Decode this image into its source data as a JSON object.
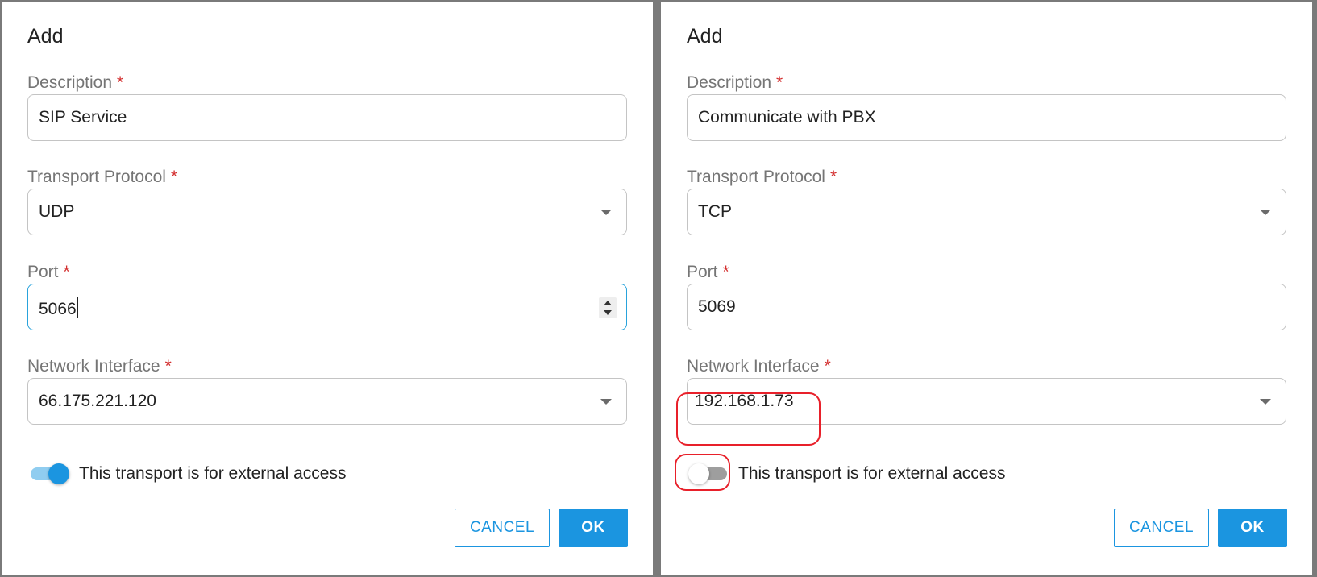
{
  "dialogs": [
    {
      "title": "Add",
      "description_label": "Description",
      "description_value": "SIP Service",
      "protocol_label": "Transport Protocol",
      "protocol_value": "UDP",
      "port_label": "Port",
      "port_value": "5066",
      "interface_label": "Network Interface",
      "interface_value": "66.175.221.120",
      "external_access_label": "This transport is for external access",
      "external_access_on": true,
      "cancel_label": "CANCEL",
      "ok_label": "OK"
    },
    {
      "title": "Add",
      "description_label": "Description",
      "description_value": "Communicate with PBX",
      "protocol_label": "Transport Protocol",
      "protocol_value": "TCP",
      "port_label": "Port",
      "port_value": "5069",
      "interface_label": "Network Interface",
      "interface_value": "192.168.1.73",
      "external_access_label": "This transport is for external access",
      "external_access_on": false,
      "cancel_label": "CANCEL",
      "ok_label": "OK"
    }
  ],
  "required_marker": "*",
  "colors": {
    "accent": "#1b95e0",
    "required": "#d32f2f",
    "annotation": "#e8202a"
  }
}
